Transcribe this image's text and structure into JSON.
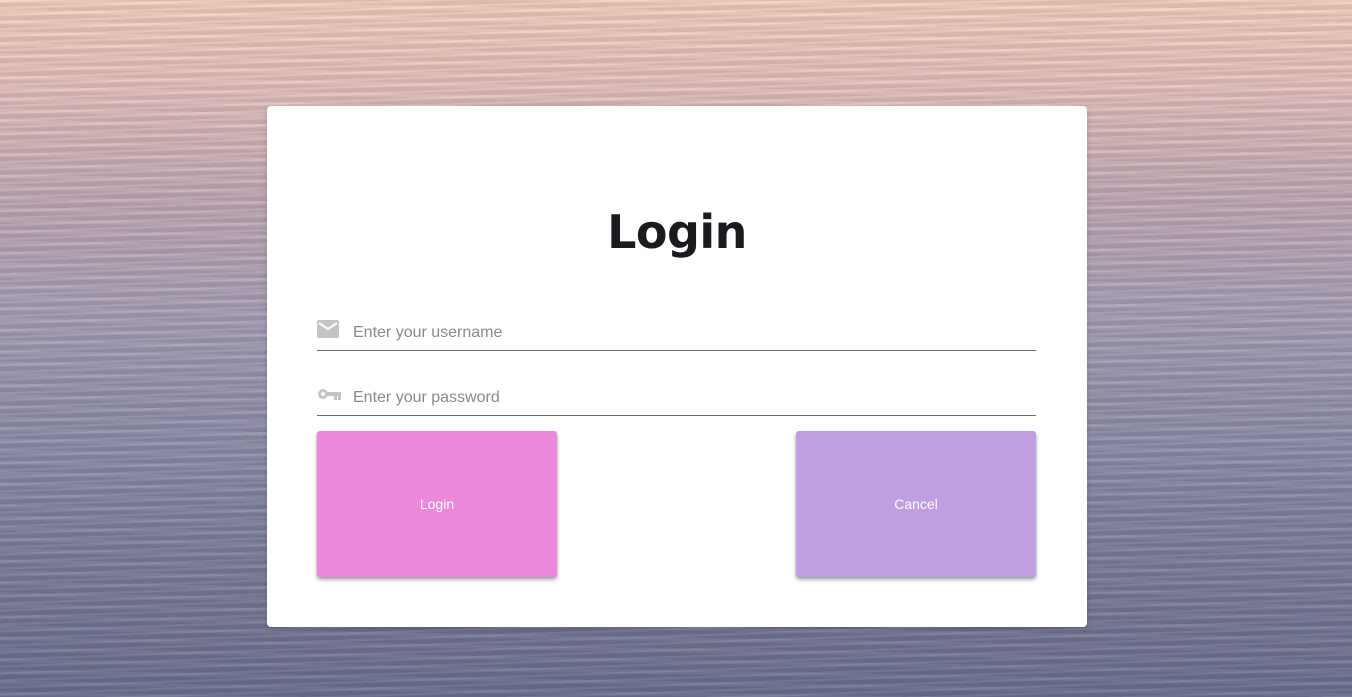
{
  "login_form": {
    "title": "Login",
    "username": {
      "placeholder": "Enter your username",
      "value": "",
      "icon": "mail-icon"
    },
    "password": {
      "placeholder": "Enter your password",
      "value": "",
      "icon": "key-icon"
    },
    "buttons": {
      "login_label": "Login",
      "cancel_label": "Cancel"
    }
  },
  "colors": {
    "login_button": "#eb88dc",
    "cancel_button": "#c19ee2",
    "title_text": "#1b1b1f",
    "icon": "#c4c4c4"
  }
}
